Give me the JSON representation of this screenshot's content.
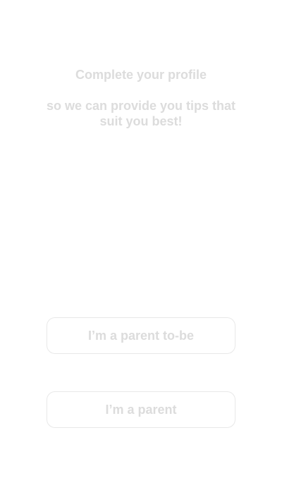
{
  "header": {
    "title": "Complete your profile",
    "subtitle": "so we can provide you tips that suit you best!"
  },
  "choices": {
    "parent_to_be_label": "I’m a parent to-be",
    "parent_label": "I’m a parent"
  },
  "colors": {
    "text": "#dcdcdc",
    "button_border": "#e8e8e8",
    "background": "#ffffff"
  }
}
